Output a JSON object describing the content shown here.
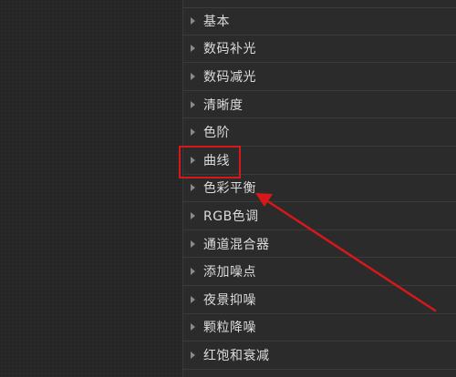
{
  "panel": {
    "items": [
      {
        "label": "基本"
      },
      {
        "label": "数码补光"
      },
      {
        "label": "数码减光"
      },
      {
        "label": "清晰度"
      },
      {
        "label": "色阶"
      },
      {
        "label": "曲线"
      },
      {
        "label": "色彩平衡"
      },
      {
        "label": "RGB色调"
      },
      {
        "label": "通道混合器"
      },
      {
        "label": "添加噪点"
      },
      {
        "label": "夜景抑噪"
      },
      {
        "label": "颗粒降噪"
      },
      {
        "label": "红饱和衰减"
      }
    ]
  },
  "annotation": {
    "highlighted_item": "曲线",
    "color": "#d7181b"
  },
  "colors": {
    "background": "#262626",
    "panel": "#2b2b2b",
    "text": "#dcdcdc",
    "accent": "#d7181b"
  }
}
